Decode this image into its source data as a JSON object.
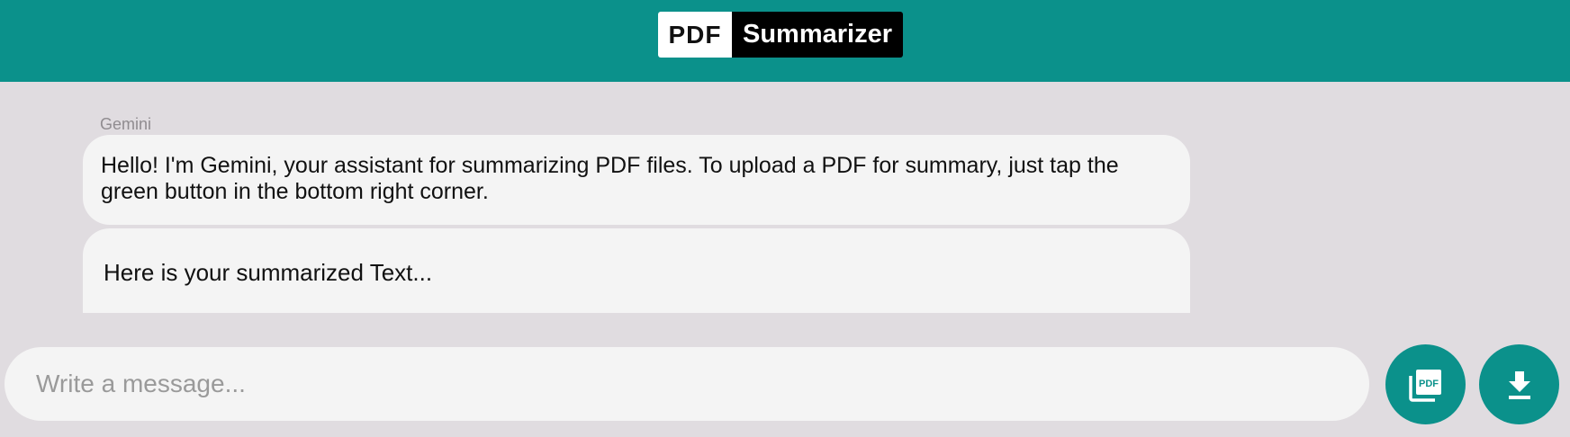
{
  "header": {
    "logo_pdf": "PDF",
    "logo_name": "Summarizer",
    "background_color": "#0b918b"
  },
  "chat": {
    "sender": "Gemini",
    "messages": [
      {
        "text": "Hello! I'm Gemini, your assistant for summarizing PDF files. To upload a PDF for summary, just tap the green button in the bottom right corner."
      },
      {
        "text": "Here is your summarized Text..."
      }
    ]
  },
  "composer": {
    "placeholder": "Write a message...",
    "value": ""
  },
  "actions": {
    "upload_pdf_icon": "pdf-file-icon",
    "download_icon": "download-icon",
    "accent_color": "#0b918b"
  }
}
